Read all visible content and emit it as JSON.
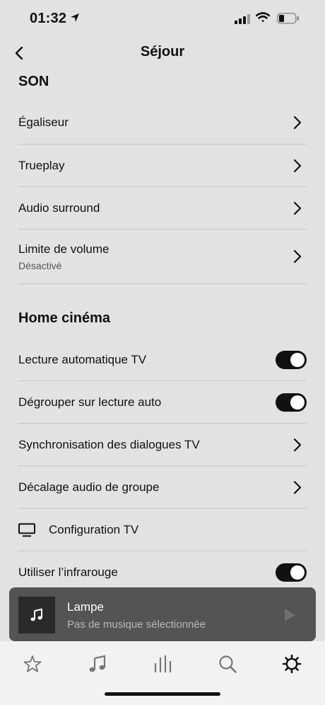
{
  "status_bar": {
    "time": "01:32"
  },
  "header": {
    "title": "Séjour"
  },
  "sections": {
    "son": {
      "title": "SON",
      "rows": [
        {
          "label": "Égaliseur"
        },
        {
          "label": "Trueplay"
        },
        {
          "label": "Audio surround"
        },
        {
          "label": "Limite de volume",
          "sublabel": "Désactivé"
        }
      ]
    },
    "home_cinema": {
      "title": "Home cinéma",
      "rows": [
        {
          "label": "Lecture automatique TV",
          "toggle": true
        },
        {
          "label": "Dégrouper sur lecture auto",
          "toggle": true
        },
        {
          "label": "Synchronisation des dialogues TV"
        },
        {
          "label": "Décalage audio de groupe"
        },
        {
          "label": "Configuration TV",
          "icon": "tv-icon"
        },
        {
          "label": "Utiliser l’infrarouge",
          "toggle": true
        }
      ]
    }
  },
  "now_playing": {
    "title": "Lampe",
    "subtitle": "Pas de musique sélectionnée"
  },
  "tab_bar": {
    "tabs": [
      "star-icon",
      "music-note-icon",
      "rooms-bars-icon",
      "search-icon",
      "gear-icon"
    ],
    "active": "gear-icon"
  },
  "colors": {
    "background": "#e2e2e2",
    "toggle_on": "#111111",
    "now_playing_bg": "#545454",
    "tab_bar_bg": "#f2f2f2"
  }
}
